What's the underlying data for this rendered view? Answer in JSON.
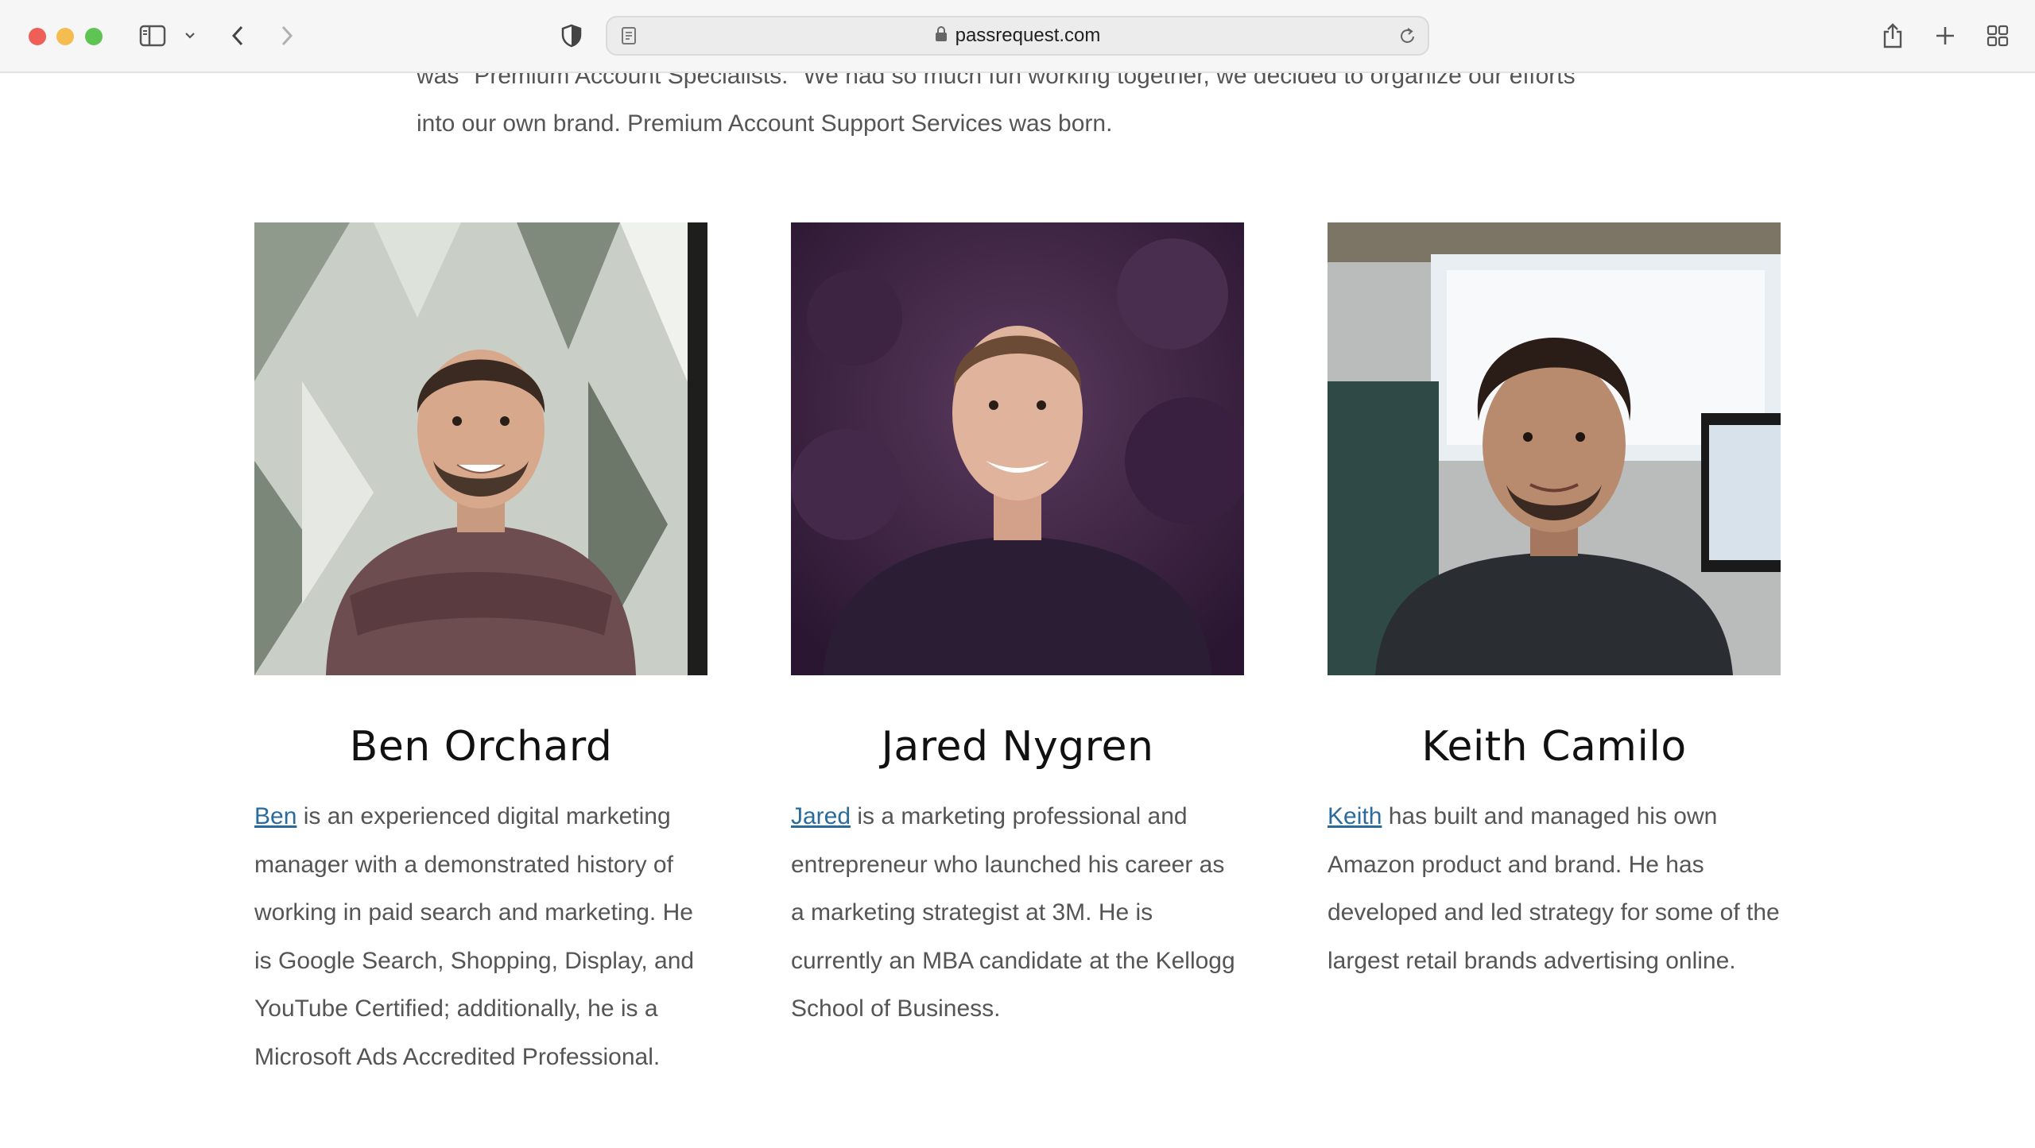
{
  "browser": {
    "url": "passrequest.com",
    "icons": [
      "sidebar-icon",
      "chevron-down-icon",
      "back-icon",
      "forward-icon",
      "privacy-shield-icon",
      "reader-icon",
      "lock-icon",
      "reload-icon",
      "share-icon",
      "new-tab-icon",
      "tab-overview-icon"
    ]
  },
  "intro": {
    "line_cut": "was \"Premium Account Specialists.\" We had so much fun working together, we decided to organize our efforts",
    "line_last": "into our own brand. Premium Account Support Services was born."
  },
  "team": [
    {
      "name": "Ben Orchard",
      "link": "Ben",
      "bio": " is an experienced digital marketing manager with a demonstrated history of working in paid search and marketing. He is Google Search, Shopping, Display, and YouTube Certified; additionally, he is a Microsoft Ads Accredited Professional."
    },
    {
      "name": "Jared Nygren",
      "link": "Jared",
      "bio": " is a marketing professional and entrepreneur who launched his career as a marketing strategist at 3M. He is currently an MBA candidate at the Kellogg School of Business."
    },
    {
      "name": "Keith Camilo",
      "link": "Keith",
      "bio": " has built and managed his own Amazon product and brand. He has developed and led strategy for some of the largest retail brands advertising online."
    }
  ]
}
